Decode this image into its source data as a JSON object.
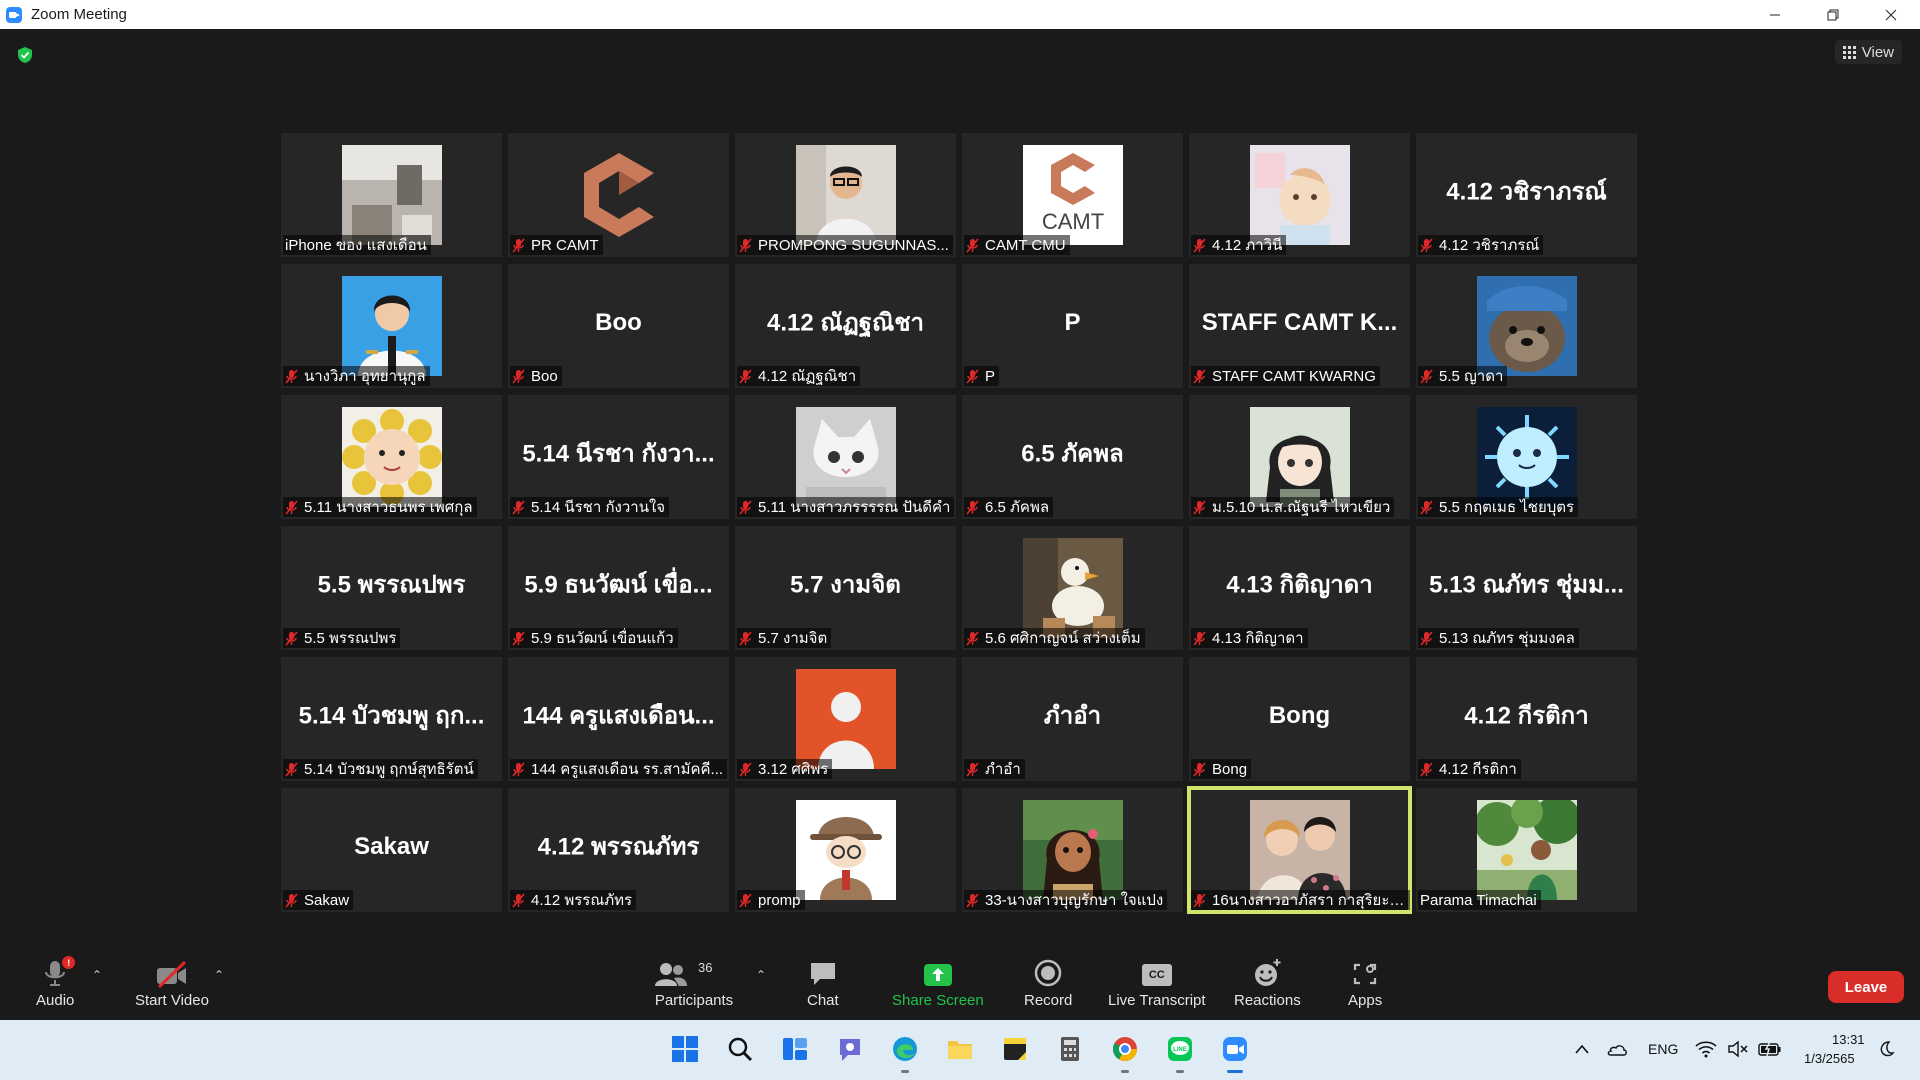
{
  "window": {
    "title": "Zoom Meeting"
  },
  "top": {
    "view_label": "View"
  },
  "tiles": [
    {
      "label": "iPhone ของ แสงเดือน",
      "muted": false,
      "visual": "photo-room"
    },
    {
      "label": "PR CAMT",
      "muted": true,
      "visual": "logo-c"
    },
    {
      "label": "PROMPONG SUGUNNAS...",
      "muted": true,
      "visual": "photo-person"
    },
    {
      "label": "CAMT CMU",
      "muted": true,
      "visual": "logo-camt",
      "caption": "CAMT"
    },
    {
      "label": "4.12 ภาวินี",
      "muted": true,
      "visual": "cartoon-pastel"
    },
    {
      "label": "4.12 วชิราภรณ์",
      "muted": true,
      "name": "4.12 วชิราภรณ์"
    },
    {
      "label": "นางวิภา อุทยานุกูล",
      "muted": true,
      "visual": "photo-portrait"
    },
    {
      "label": "Boo",
      "muted": true,
      "name": "Boo"
    },
    {
      "label": "4.12 ณัฏฐณิชา",
      "muted": true,
      "name": "4.12 ณัฏฐณิชา"
    },
    {
      "label": "P",
      "muted": true,
      "name": "P"
    },
    {
      "label": "STAFF CAMT KWARNG",
      "muted": true,
      "name": "STAFF CAMT K..."
    },
    {
      "label": "5.5 ญาดา",
      "muted": true,
      "visual": "otter"
    },
    {
      "label": "5.11 นางสาวธนพร เพศกุล",
      "muted": true,
      "visual": "sunflower"
    },
    {
      "label": "5.14 นีรชา กังวานใจ",
      "muted": true,
      "name": "5.14 นีรชา กังวา..."
    },
    {
      "label": "5.11 นางสาวภรรรรณ ปันดีคำ",
      "muted": true,
      "visual": "cat"
    },
    {
      "label": "6.5 ภัคพล",
      "muted": true,
      "name": "6.5 ภัคพล"
    },
    {
      "label": "ม.5.10 น.ส.ณัฐนรี ไหวเขียว",
      "muted": true,
      "visual": "anime"
    },
    {
      "label": "5.5 กฤตเมธ ไชยบุตร",
      "muted": true,
      "visual": "virus-cartoon"
    },
    {
      "label": "5.5 พรรณปพร",
      "muted": true,
      "name": "5.5 พรรณปพร"
    },
    {
      "label": "5.9 ธนวัฒน์ เขื่อนแก้ว",
      "muted": true,
      "name": "5.9 ธนวัฒน์ เขื่อ..."
    },
    {
      "label": "5.7 งามจิต",
      "muted": true,
      "name": "5.7 งามจิต"
    },
    {
      "label": "5.6 ศศิกาญจน์ สว่างเต็ม",
      "muted": true,
      "visual": "duck"
    },
    {
      "label": "4.13 กิติญาดา",
      "muted": true,
      "name": "4.13 กิติญาดา"
    },
    {
      "label": "5.13 ณภัทร ชุ่มมงคล",
      "muted": true,
      "name": "5.13 ณภัทร ชุ่มม..."
    },
    {
      "label": "5.14 บัวชมพู ฤกษ์สุทธิรัตน์",
      "muted": true,
      "name": "5.14 บัวชมพู ฤก..."
    },
    {
      "label": "144 ครูแสงเดือน รร.สามัคคี...",
      "muted": true,
      "name": "144 ครูแสงเดือน..."
    },
    {
      "label": "3.12 ศศิพร",
      "muted": true,
      "visual": "avatar-default"
    },
    {
      "label": "ภำอำ",
      "muted": true,
      "name": "ภำอำ"
    },
    {
      "label": "Bong",
      "muted": true,
      "name": "Bong"
    },
    {
      "label": "4.12 กีรติกา",
      "muted": true,
      "name": "4.12 กีรติกา"
    },
    {
      "label": "Sakaw",
      "muted": true,
      "name": "Sakaw"
    },
    {
      "label": "4.12 พรรณภัทร",
      "muted": true,
      "name": "4.12 พรรณภัทร"
    },
    {
      "label": "promp",
      "muted": true,
      "visual": "detective"
    },
    {
      "label": "33-นางสาวบุญรักษา ใจแปง",
      "muted": true,
      "visual": "moana"
    },
    {
      "label": "16นางสาวอาภัสรา กาสุริยะ [...",
      "muted": true,
      "visual": "couple-photo",
      "active": true
    },
    {
      "label": "Parama Timachai",
      "muted": false,
      "visual": "outdoor-photo"
    }
  ],
  "toolbar": {
    "audio": "Audio",
    "audio_badge": "!",
    "start_video": "Start Video",
    "participants": "Participants",
    "participants_count": "36",
    "chat": "Chat",
    "share_screen": "Share Screen",
    "record": "Record",
    "live_transcript": "Live Transcript",
    "live_transcript_icon_text": "CC",
    "reactions": "Reactions",
    "apps": "Apps",
    "leave": "Leave"
  },
  "taskbar": {
    "language": "ENG",
    "time": "13:31",
    "date": "1/3/2565"
  },
  "colors": {
    "background": "#1a1a1a",
    "tile": "#262626",
    "active_speaker": "#cfe56b",
    "share_green": "#23c34b",
    "leave_red": "#d92d2a",
    "muted_red": "#e02828"
  }
}
